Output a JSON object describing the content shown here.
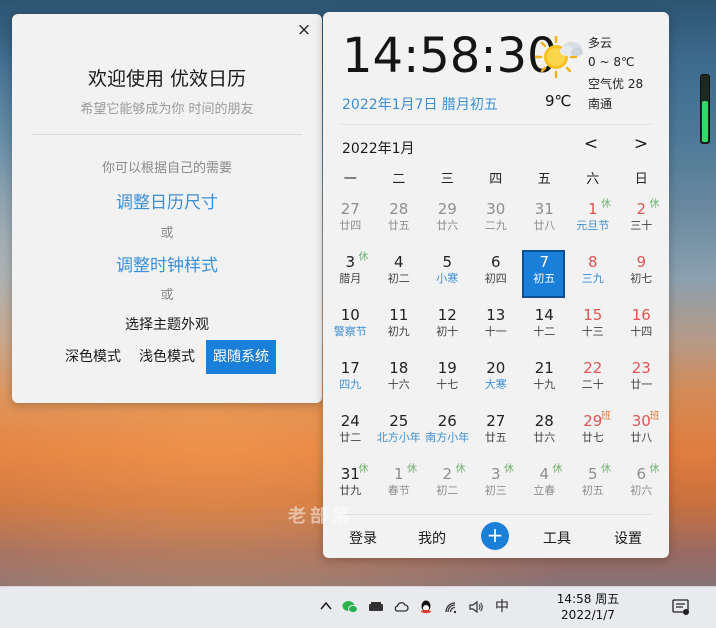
{
  "welcome": {
    "title": "欢迎使用 优效日历",
    "subtitle": "希望它能够成为你 时间的朋友",
    "hint": "你可以根据自己的需要",
    "link_size": "调整日历尺寸",
    "or_1": "或",
    "link_clock": "调整时钟样式",
    "or_2": "或",
    "theme_label": "选择主题外观",
    "theme_dark": "深色模式",
    "theme_light": "浅色模式",
    "theme_system": "跟随系统",
    "close_symbol": "×"
  },
  "clock": {
    "time": "14:58:30",
    "date": "2022年1月7日 腊月初五"
  },
  "weather": {
    "icon": "partly-cloudy-icon",
    "temperature": "9℃",
    "condition": "多云",
    "range": "0 ~ 8℃",
    "air": "空气优 28",
    "city": "南通"
  },
  "calendar": {
    "month_label": "2022年1月",
    "prev": "<",
    "next": ">",
    "weekdays": [
      "一",
      "二",
      "三",
      "四",
      "五",
      "六",
      "日"
    ],
    "days": [
      {
        "num": "27",
        "lunar": "廿四",
        "other": true
      },
      {
        "num": "28",
        "lunar": "廿五",
        "other": true
      },
      {
        "num": "29",
        "lunar": "廿六",
        "other": true
      },
      {
        "num": "30",
        "lunar": "二九",
        "other": true
      },
      {
        "num": "31",
        "lunar": "廿八",
        "other": true
      },
      {
        "num": "1",
        "lunar": "元旦节",
        "weekend": true,
        "festival": true,
        "mark": "休"
      },
      {
        "num": "2",
        "lunar": "三十",
        "weekend": true,
        "mark": "休"
      },
      {
        "num": "3",
        "lunar": "腊月",
        "mark": "休"
      },
      {
        "num": "4",
        "lunar": "初二"
      },
      {
        "num": "5",
        "lunar": "小寒",
        "festival": true
      },
      {
        "num": "6",
        "lunar": "初四"
      },
      {
        "num": "7",
        "lunar": "初五",
        "today": true
      },
      {
        "num": "8",
        "lunar": "三九",
        "weekend": true,
        "festival": true
      },
      {
        "num": "9",
        "lunar": "初七",
        "weekend": true
      },
      {
        "num": "10",
        "lunar": "警察节",
        "festival": true
      },
      {
        "num": "11",
        "lunar": "初九"
      },
      {
        "num": "12",
        "lunar": "初十"
      },
      {
        "num": "13",
        "lunar": "十一"
      },
      {
        "num": "14",
        "lunar": "十二"
      },
      {
        "num": "15",
        "lunar": "十三",
        "weekend": true
      },
      {
        "num": "16",
        "lunar": "十四",
        "weekend": true
      },
      {
        "num": "17",
        "lunar": "四九",
        "festival": true
      },
      {
        "num": "18",
        "lunar": "十六"
      },
      {
        "num": "19",
        "lunar": "十七"
      },
      {
        "num": "20",
        "lunar": "大寒",
        "festival": true
      },
      {
        "num": "21",
        "lunar": "十九"
      },
      {
        "num": "22",
        "lunar": "二十",
        "weekend": true
      },
      {
        "num": "23",
        "lunar": "廿一",
        "weekend": true
      },
      {
        "num": "24",
        "lunar": "廿二"
      },
      {
        "num": "25",
        "lunar": "北方小年",
        "festival": true
      },
      {
        "num": "26",
        "lunar": "南方小年",
        "festival": true
      },
      {
        "num": "27",
        "lunar": "廿五"
      },
      {
        "num": "28",
        "lunar": "廿六"
      },
      {
        "num": "29",
        "lunar": "廿七",
        "weekend": true,
        "mark": "班"
      },
      {
        "num": "30",
        "lunar": "廿八",
        "weekend": true,
        "mark": "班"
      },
      {
        "num": "31",
        "lunar": "廿九",
        "mark": "休"
      },
      {
        "num": "1",
        "lunar": "春节",
        "other": true,
        "mark": "休"
      },
      {
        "num": "2",
        "lunar": "初二",
        "other": true,
        "mark": "休"
      },
      {
        "num": "3",
        "lunar": "初三",
        "other": true,
        "mark": "休"
      },
      {
        "num": "4",
        "lunar": "立春",
        "other": true,
        "mark": "休"
      },
      {
        "num": "5",
        "lunar": "初五",
        "other": true,
        "mark": "休"
      },
      {
        "num": "6",
        "lunar": "初六",
        "other": true,
        "mark": "休"
      }
    ]
  },
  "bottom_bar": {
    "login": "登录",
    "mine": "我的",
    "add": "+",
    "tools": "工具",
    "settings": "设置"
  },
  "watermark": "老部落",
  "taskbar": {
    "time": "14:58 周五",
    "date": "2022/1/7",
    "chevron": "^",
    "ime": "中"
  },
  "colors": {
    "accent": "#1a7fd8",
    "link": "#3c8fd6",
    "weekend": "#e05552",
    "holiday_mark": "#6fb36f",
    "work_mark": "#e07b38"
  },
  "battery_meter_level": 0.62
}
